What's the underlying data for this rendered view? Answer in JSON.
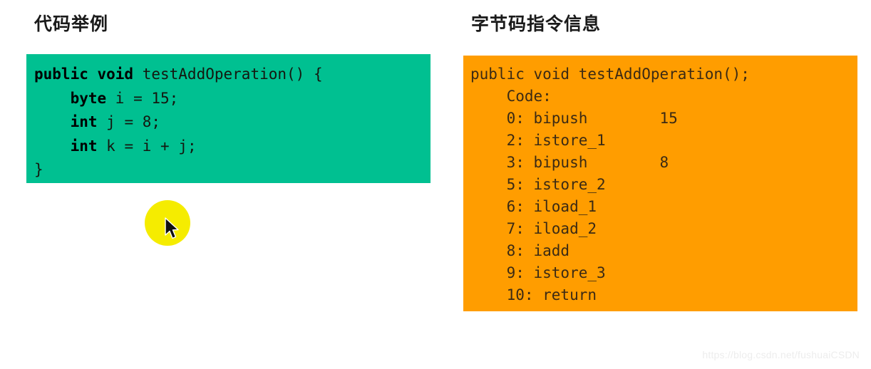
{
  "panels": {
    "left": {
      "title": "代码举例",
      "background_color": "#00c091",
      "language": "java",
      "lines": [
        [
          {
            "t": "public void",
            "kw": true
          },
          {
            "t": " testAddOperation() {",
            "kw": false
          }
        ],
        [
          {
            "t": "    byte",
            "kw": true
          },
          {
            "t": " i = 15;",
            "kw": false
          }
        ],
        [
          {
            "t": "    int",
            "kw": true
          },
          {
            "t": " j = 8;",
            "kw": false
          }
        ],
        [
          {
            "t": "    int",
            "kw": true
          },
          {
            "t": " k = i + j;",
            "kw": false
          }
        ],
        [
          {
            "t": "}",
            "kw": false
          }
        ]
      ],
      "plain_text": "public void testAddOperation() {\n    byte i = 15;\n    int j = 8;\n    int k = i + j;\n}"
    },
    "right": {
      "title": "字节码指令信息",
      "background_color": "#ff9d00",
      "lines": [
        "public void testAddOperation();",
        "    Code:",
        "    0: bipush        15",
        "    2: istore_1",
        "    3: bipush        8",
        "    5: istore_2",
        "    6: iload_1",
        "    7: iload_2",
        "    8: iadd",
        "    9: istore_3",
        "    10: return"
      ],
      "instructions": [
        {
          "offset": "0",
          "mnemonic": "bipush",
          "operand": "15"
        },
        {
          "offset": "2",
          "mnemonic": "istore_1",
          "operand": ""
        },
        {
          "offset": "3",
          "mnemonic": "bipush",
          "operand": "8"
        },
        {
          "offset": "5",
          "mnemonic": "istore_2",
          "operand": ""
        },
        {
          "offset": "6",
          "mnemonic": "iload_1",
          "operand": ""
        },
        {
          "offset": "7",
          "mnemonic": "iload_2",
          "operand": ""
        },
        {
          "offset": "8",
          "mnemonic": "iadd",
          "operand": ""
        },
        {
          "offset": "9",
          "mnemonic": "istore_3",
          "operand": ""
        },
        {
          "offset": "10",
          "mnemonic": "return",
          "operand": ""
        }
      ]
    }
  },
  "pointer": {
    "highlight_color": "#f5ec00",
    "cursor_icon": "arrow-cursor-icon"
  },
  "watermark": {
    "text": "https://blog.csdn.net/fushuaiCSDN"
  }
}
